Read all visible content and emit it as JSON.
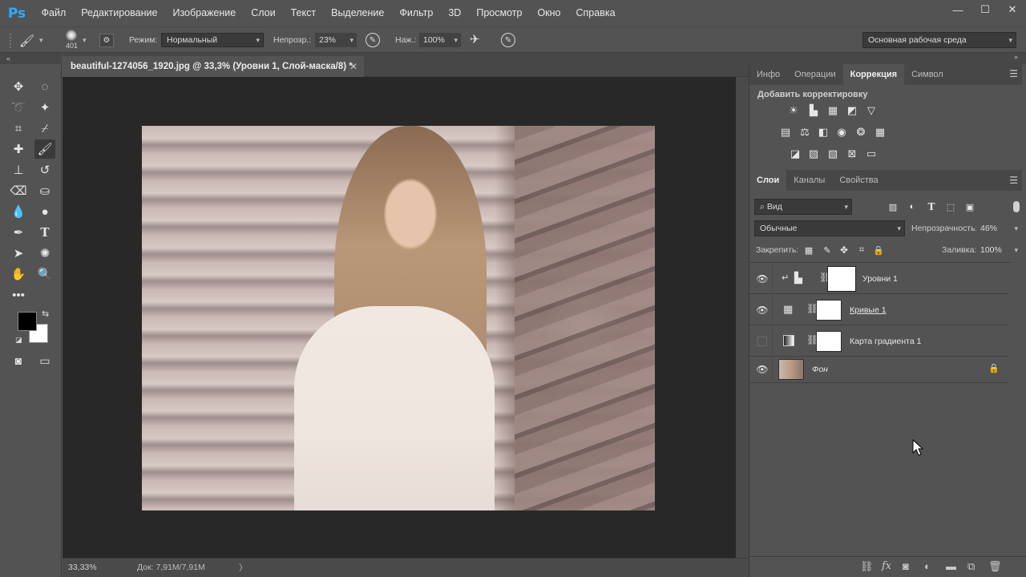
{
  "app": {
    "logo": "Ps"
  },
  "menu": [
    "Файл",
    "Редактирование",
    "Изображение",
    "Слои",
    "Текст",
    "Выделение",
    "Фильтр",
    "3D",
    "Просмотр",
    "Окно",
    "Справка"
  ],
  "window_controls": {
    "minimize": "—",
    "restore": "☐",
    "close": "✕"
  },
  "options_bar": {
    "brush_size": "401",
    "mode_label": "Режим:",
    "mode_value": "Нормальный",
    "opacity_label": "Непрозр.:",
    "opacity_value": "23%",
    "flow_label": "Наж.:",
    "flow_value": "100%",
    "workspace_value": "Основная рабочая среда"
  },
  "document": {
    "tab_title": "beautiful-1274056_1920.jpg @ 33,3% (Уровни 1, Слой-маска/8) *",
    "close_glyph": "✕"
  },
  "status_bar": {
    "zoom": "33,33%",
    "doc_size": "Док: 7,91M/7,91M",
    "arrow": "〉"
  },
  "top_panel": {
    "tabs": [
      "Инфо",
      "Операции",
      "Коррекция",
      "Символ"
    ],
    "active_tab": "Коррекция",
    "heading": "Добавить корректировку"
  },
  "layers_panel": {
    "tabs": [
      "Слои",
      "Каналы",
      "Свойства"
    ],
    "active_tab": "Слои",
    "filter_kind": "Вид",
    "blend_mode": "Обычные",
    "opacity_label": "Непрозрачность:",
    "opacity_value": "46%",
    "lock_label": "Закрепить:",
    "fill_label": "Заливка:",
    "fill_value": "100%",
    "layers": [
      {
        "name": "Уровни 1",
        "visible": true,
        "selected": true,
        "adjustment_icon": "levels-icon",
        "clipped": true
      },
      {
        "name": "Кривые 1",
        "visible": true,
        "selected": false,
        "adjustment_icon": "curves-icon",
        "underlined": true
      },
      {
        "name": "Карта градиента 1",
        "visible": false,
        "selected": false,
        "adjustment_icon": "gradient-map-icon"
      },
      {
        "name": "Фон",
        "visible": true,
        "selected": false,
        "locked": true,
        "italic": true
      }
    ]
  },
  "colors": {
    "ui_bg": "#535353",
    "workspace": "#282828",
    "foreground": "#000000",
    "background": "#ffffff",
    "ps_blue": "#31a8ff"
  }
}
